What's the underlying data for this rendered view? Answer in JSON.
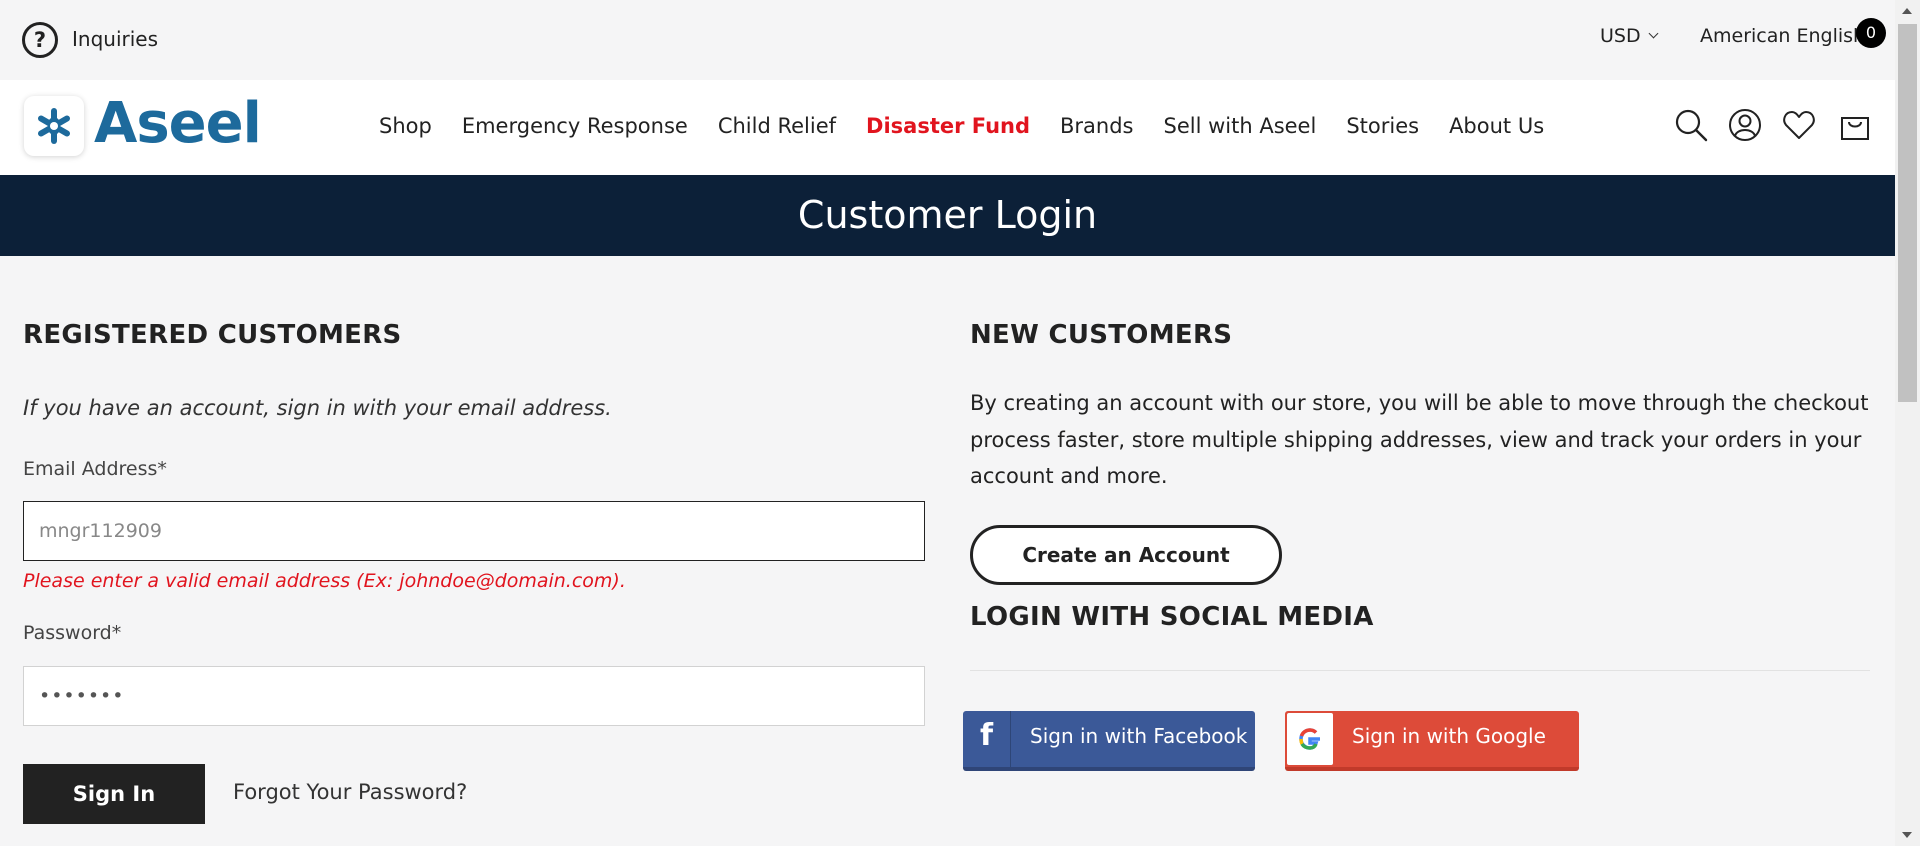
{
  "utility": {
    "inquiries_label": "Inquiries",
    "currency": "USD",
    "language": "American English"
  },
  "brand": {
    "name": "Aseel",
    "color": "#1d6a9c"
  },
  "nav": {
    "items": [
      "Shop",
      "Emergency Response",
      "Child Relief",
      "Disaster Fund",
      "Brands",
      "Sell with Aseel",
      "Stories",
      "About Us"
    ],
    "highlight": "Disaster Fund",
    "highlight_color": "#e1141e"
  },
  "header_icons": [
    "search-icon",
    "account-icon",
    "wishlist-heart-icon",
    "cart-bag-icon"
  ],
  "cart": {
    "count": "0"
  },
  "banner": {
    "title": "Customer Login",
    "color": "#0c2038"
  },
  "login": {
    "heading": "REGISTERED CUSTOMERS",
    "intro": "If you have an account, sign in with your email address.",
    "email_label": "Email Address*",
    "email_value": "mngr112909",
    "email_error": "Please enter a valid email address (Ex: johndoe@domain.com).",
    "password_label": "Password*",
    "password_mask": "•••••••",
    "signin_label": "Sign In",
    "forgot_label": "Forgot Your Password?"
  },
  "new_customers": {
    "heading": "NEW CUSTOMERS",
    "description": "By creating an account with our store, you will be able to move through the checkout process faster, store multiple shipping addresses, view and track your orders in your account and more.",
    "create_label": "Create an Account"
  },
  "social": {
    "heading": "LOGIN WITH SOCIAL MEDIA",
    "facebook_label": "Sign in with Facebook",
    "google_label": "Sign in with Google",
    "facebook_color": "#3b5998",
    "google_color": "#dd4b39"
  }
}
